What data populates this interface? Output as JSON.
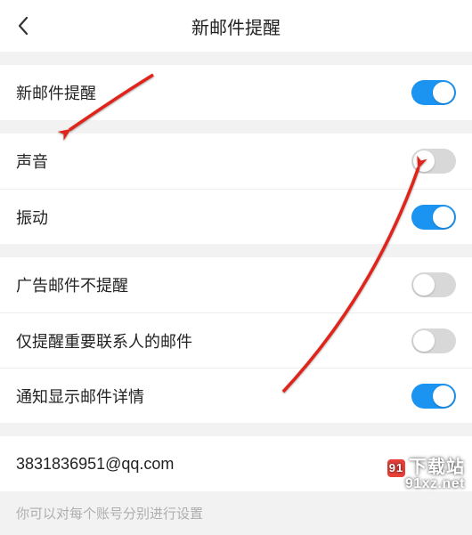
{
  "header": {
    "title": "新邮件提醒"
  },
  "group1": {
    "row1": {
      "label": "新邮件提醒",
      "toggle": true
    }
  },
  "group2": {
    "row1": {
      "label": "声音",
      "toggle": false
    },
    "row2": {
      "label": "振动",
      "toggle": true
    }
  },
  "group3": {
    "row1": {
      "label": "广告邮件不提醒",
      "toggle": false
    },
    "row2": {
      "label": "仅提醒重要联系人的邮件",
      "toggle": false
    },
    "row3": {
      "label": "通知显示邮件详情",
      "toggle": true
    }
  },
  "group4": {
    "row1": {
      "label": "3831836951@qq.com"
    }
  },
  "footer": {
    "text": "你可以对每个账号分别进行设置"
  },
  "watermark": {
    "brand_cn": "下载站",
    "brand_url": "91xz.net"
  }
}
